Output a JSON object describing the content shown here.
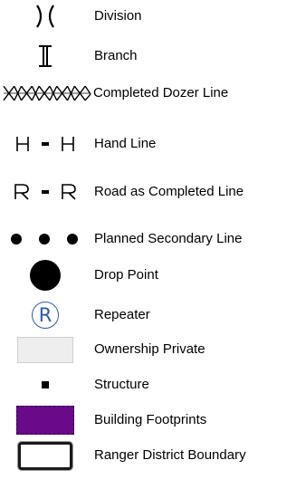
{
  "legend": {
    "items": [
      {
        "label": "Division",
        "symbol": "division-symbol"
      },
      {
        "label": "Branch",
        "symbol": "branch-symbol"
      },
      {
        "label": "Completed Dozer Line",
        "symbol": "x-chain-line"
      },
      {
        "label": "Hand Line",
        "symbol": "h-dash-h-line",
        "glyph": "H"
      },
      {
        "label": "Road as Completed Line",
        "symbol": "r-dash-r-line",
        "glyph": "R"
      },
      {
        "label": "Planned Secondary Line",
        "symbol": "three-dots-line"
      },
      {
        "label": "Drop Point",
        "symbol": "filled-circle"
      },
      {
        "label": "Repeater",
        "symbol": "circled-r",
        "glyph": "R",
        "color": "#2d5ba8"
      },
      {
        "label": "Ownership Private",
        "symbol": "light-gray-fill",
        "color": "#eeeeee"
      },
      {
        "label": "Structure",
        "symbol": "small-black-square"
      },
      {
        "label": "Building Footprints",
        "symbol": "purple-fill",
        "color": "#6a0a8b"
      },
      {
        "label": "Ranger District Boundary",
        "symbol": "dark-outline-box"
      }
    ]
  }
}
